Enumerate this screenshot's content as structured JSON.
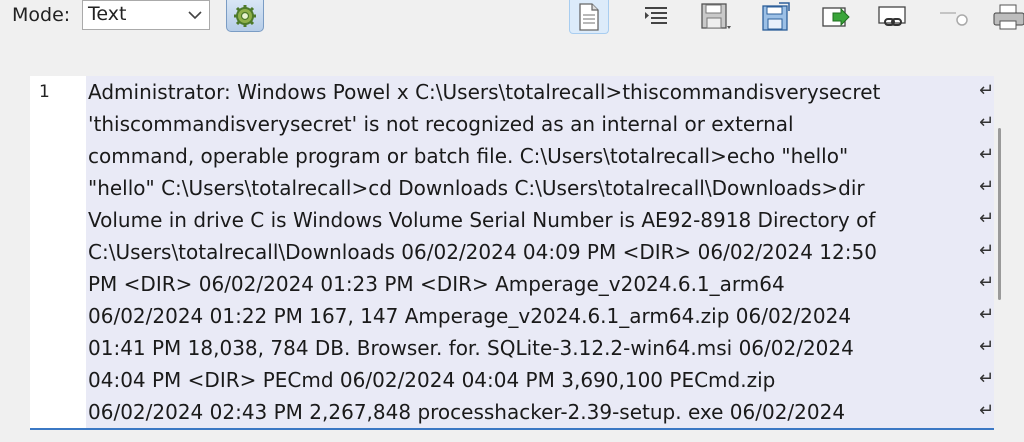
{
  "toolbar": {
    "mode_label": "Mode:",
    "mode_value": "Text",
    "buttons": [
      "text-view",
      "word-wrap",
      "save",
      "save-as",
      "export",
      "link",
      "toggle",
      "print"
    ]
  },
  "editor": {
    "line_number": "1",
    "lines": [
      "Administrator: Windows Powel x C:\\Users\\totalrecall>thiscommandisverysecret",
      "'thiscommandisverysecret' is not recognized as an internal or external",
      "command, operable program or batch file. C:\\Users\\totalrecall>echo \"hello\"",
      "\"hello\" C:\\Users\\totalrecall>cd Downloads C:\\Users\\totalrecall\\Downloads>dir",
      "Volume in drive C is Windows Volume Serial Number is AE92-8918 Directory of",
      "C:\\Users\\totalrecall\\Downloads 06/02/2024 04:09 PM <DIR> 06/02/2024 12:50",
      "PM <DIR> 06/02/2024 01:23 PM <DIR> Amperage_v2024.6.1_arm64",
      "06/02/2024 01:22 PM 167, 147 Amperage_v2024.6.1_arm64.zip 06/02/2024",
      "01:41 PM 18,038, 784 DB. Browser. for. SQLite-3.12.2-win64.msi 06/02/2024",
      "04:04 PM <DIR> PECmd 06/02/2024 04:04 PM 3,690,100 PECmd.zip",
      "06/02/2024 02:43 PM 2,267,848 processhacker-2.39-setup. exe 06/02/2024"
    ],
    "wrap_glyph": "↵"
  }
}
